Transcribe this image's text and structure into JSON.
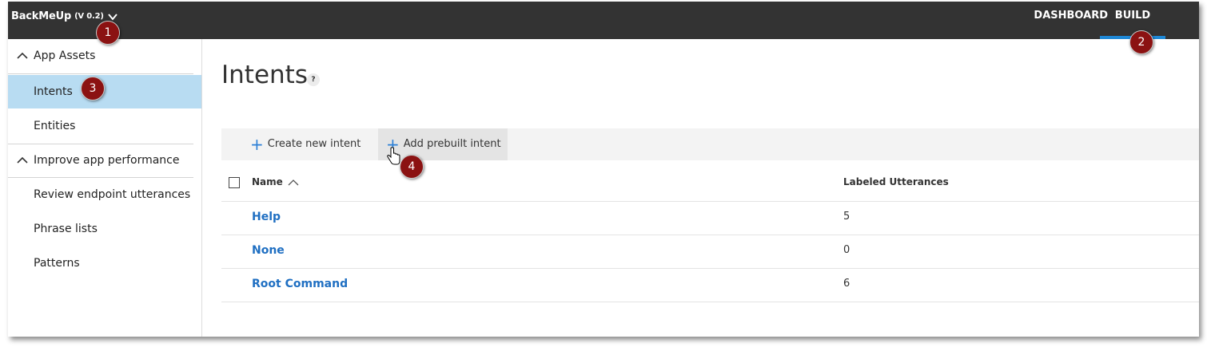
{
  "header": {
    "app_name": "BackMeUp",
    "version": "(V 0.2)",
    "nav": [
      {
        "label": "DASHBOARD"
      },
      {
        "label": "BUILD",
        "active": true
      }
    ],
    "accent_color": "#1e88d6",
    "bar_color": "#333333"
  },
  "sidebar": {
    "sections": [
      {
        "label": "App Assets",
        "items": [
          {
            "label": "Intents",
            "active": true
          },
          {
            "label": "Entities"
          }
        ]
      },
      {
        "label": "Improve app performance",
        "items": [
          {
            "label": "Review endpoint utterances"
          },
          {
            "label": "Phrase lists"
          },
          {
            "label": "Patterns"
          }
        ]
      }
    ],
    "active_color": "#b8dcf2"
  },
  "main": {
    "title": "Intents",
    "help_glyph": "?",
    "toolbar": {
      "create_label": "Create new intent",
      "add_prebuilt_label": "Add prebuilt intent"
    },
    "table": {
      "columns": [
        "Name",
        "Labeled Utterances"
      ],
      "rows": [
        {
          "name": "Help",
          "count": "5"
        },
        {
          "name": "None",
          "count": "0"
        },
        {
          "name": "Root Command",
          "count": "6"
        }
      ]
    }
  },
  "callouts": [
    "1",
    "2",
    "3",
    "4"
  ],
  "link_color": "#1f6fc2",
  "marker_color": "#8b1212"
}
